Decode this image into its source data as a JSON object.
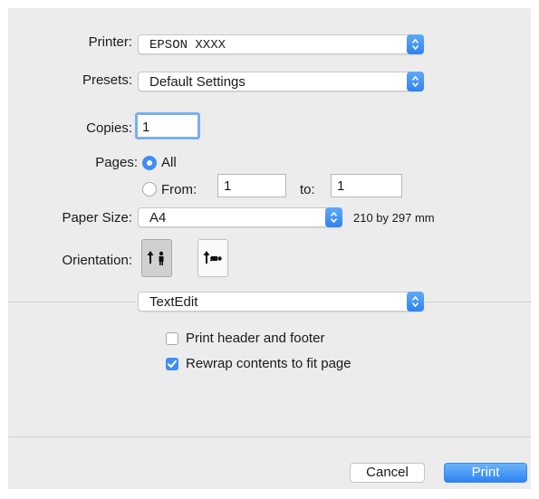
{
  "printer": {
    "label": "Printer:",
    "value": "EPSON XXXX"
  },
  "presets": {
    "label": "Presets:",
    "value": "Default Settings"
  },
  "copies": {
    "label": "Copies:",
    "value": "1"
  },
  "pages": {
    "label": "Pages:",
    "all_label": "All",
    "from_label": "From:",
    "from_value": "1",
    "to_label": "to:",
    "to_value": "1",
    "selected": "All"
  },
  "paper_size": {
    "label": "Paper Size:",
    "value": "A4",
    "dimensions": "210 by 297 mm"
  },
  "orientation": {
    "label": "Orientation:",
    "selected": "portrait",
    "options": [
      "portrait",
      "landscape"
    ]
  },
  "app_section": {
    "value": "TextEdit"
  },
  "options": [
    {
      "label": "Print header and footer",
      "checked": false
    },
    {
      "label": "Rewrap contents to fit page",
      "checked": true
    }
  ],
  "buttons": {
    "cancel": "Cancel",
    "print": "Print"
  },
  "colors": {
    "accent": "#3d8ef3",
    "dialog_bg": "#ececec"
  }
}
